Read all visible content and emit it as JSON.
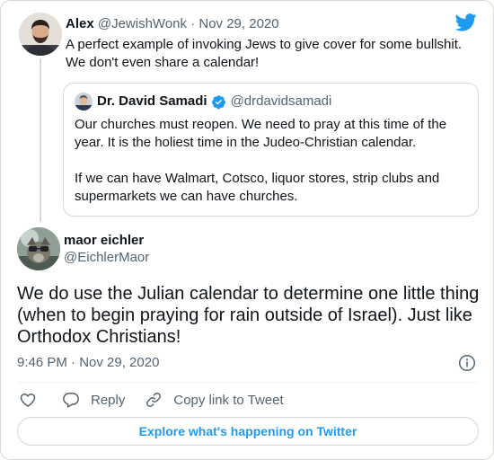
{
  "parent_tweet": {
    "name": "Alex",
    "handle": "@JewishWonk",
    "separator": "·",
    "date": "Nov 29, 2020",
    "text": "A perfect example of invoking Jews to give cover for some bullshit. We don't even share a calendar!"
  },
  "quoted_tweet": {
    "name": "Dr. David Samadi",
    "handle": "@drdavidsamadi",
    "paragraphs": [
      "Our churches must reopen. We need to pray at this time of the year. It is the holiest time in the Judeo-Christian calendar.",
      "If we can have Walmart, Cotsco, liquor stores, strip clubs and supermarkets we can have churches."
    ]
  },
  "main_tweet": {
    "name": "maor eichler",
    "handle": "@EichlerMaor",
    "text": "We do use the Julian calendar to determine one little thing (when to begin praying for rain outside of Israel). Just like Orthodox Christians!",
    "timestamp": "9:46 PM · Nov 29, 2020"
  },
  "actions": {
    "reply_label": "Reply",
    "copy_link_label": "Copy link to Tweet"
  },
  "explore_label": "Explore what's happening on Twitter",
  "colors": {
    "brand": "#1d9bf0",
    "text": "#0f1419",
    "secondary": "#536471",
    "border": "#cfd9de"
  },
  "icons": [
    "twitter-bird-icon",
    "verified-badge-icon",
    "info-icon",
    "heart-icon",
    "reply-icon",
    "link-icon"
  ]
}
